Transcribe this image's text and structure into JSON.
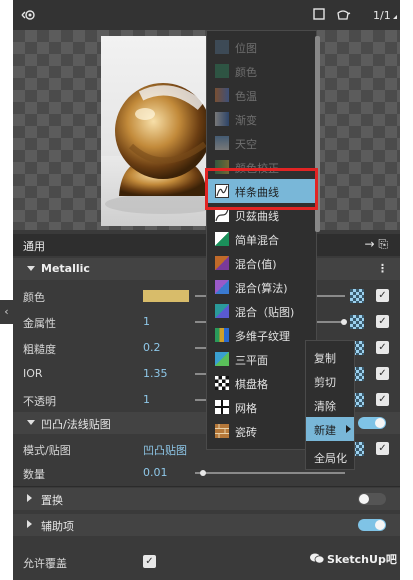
{
  "topbar": {
    "ratio_label": "1/1"
  },
  "tab": {
    "label": "通用"
  },
  "material": {
    "name": "Metallic"
  },
  "properties": [
    {
      "label": "颜色",
      "value": "",
      "color": "#d8bc6a",
      "slider": 0.05
    },
    {
      "label": "金属性",
      "value": "1",
      "slider": 1.0
    },
    {
      "label": "粗糙度",
      "value": "0.2",
      "slider": 0.2
    },
    {
      "label": "IOR",
      "value": "1.35",
      "slider": 0.3
    },
    {
      "label": "不透明",
      "value": "1",
      "slider": 1.0
    }
  ],
  "bump": {
    "section_label": "凹凸/法线贴图",
    "mode_label": "模式/贴图",
    "mode_value": "凹凸贴图",
    "amount_label": "数量",
    "amount_value": "0.01"
  },
  "sections": [
    {
      "label": "置换",
      "enabled": false
    },
    {
      "label": "辅助项",
      "enabled": true
    }
  ],
  "footer": {
    "allow_override_label": "允许覆盖"
  },
  "menu": {
    "items": [
      {
        "label": "位图",
        "icon": "bitmap-icon",
        "enabled": false
      },
      {
        "label": "颜色",
        "icon": "color-icon",
        "enabled": false
      },
      {
        "label": "色温",
        "icon": "color-temperature-icon",
        "enabled": false
      },
      {
        "label": "渐变",
        "icon": "gradient-icon",
        "enabled": false
      },
      {
        "label": "天空",
        "icon": "sky-icon",
        "enabled": false
      },
      {
        "label": "颜色校正",
        "icon": "color-correction-icon",
        "enabled": false
      },
      {
        "label": "样条曲线",
        "icon": "spline-curve-icon",
        "enabled": true,
        "highlighted": true
      },
      {
        "label": "贝兹曲线",
        "icon": "bezier-curve-icon",
        "enabled": true
      },
      {
        "label": "简单混合",
        "icon": "simple-blend-icon",
        "enabled": true
      },
      {
        "label": "混合(值)",
        "icon": "blend-value-icon",
        "enabled": true
      },
      {
        "label": "混合(算法)",
        "icon": "blend-algorithm-icon",
        "enabled": true
      },
      {
        "label": "混合（贴图)",
        "icon": "blend-texture-icon",
        "enabled": true
      },
      {
        "label": "多维子纹理",
        "icon": "multi-sub-texture-icon",
        "enabled": true
      },
      {
        "label": "三平面",
        "icon": "triplanar-icon",
        "enabled": true
      },
      {
        "label": "棋盘格",
        "icon": "checker-icon",
        "enabled": true
      },
      {
        "label": "网格",
        "icon": "grid-icon",
        "enabled": true
      },
      {
        "label": "瓷砖",
        "icon": "tile-icon",
        "enabled": true
      }
    ]
  },
  "submenu": {
    "items": [
      {
        "label": "复制",
        "highlighted": false
      },
      {
        "label": "剪切",
        "highlighted": false
      },
      {
        "label": "清除",
        "highlighted": false
      },
      {
        "label": "新建",
        "highlighted": true
      },
      {
        "label": "全局化",
        "highlighted": false
      }
    ]
  },
  "watermark": {
    "label": "SketchUp吧"
  },
  "colors": {
    "accent": "#79b7d8",
    "highlight_box": "#e12424",
    "swatch": "#d8bc6a"
  }
}
